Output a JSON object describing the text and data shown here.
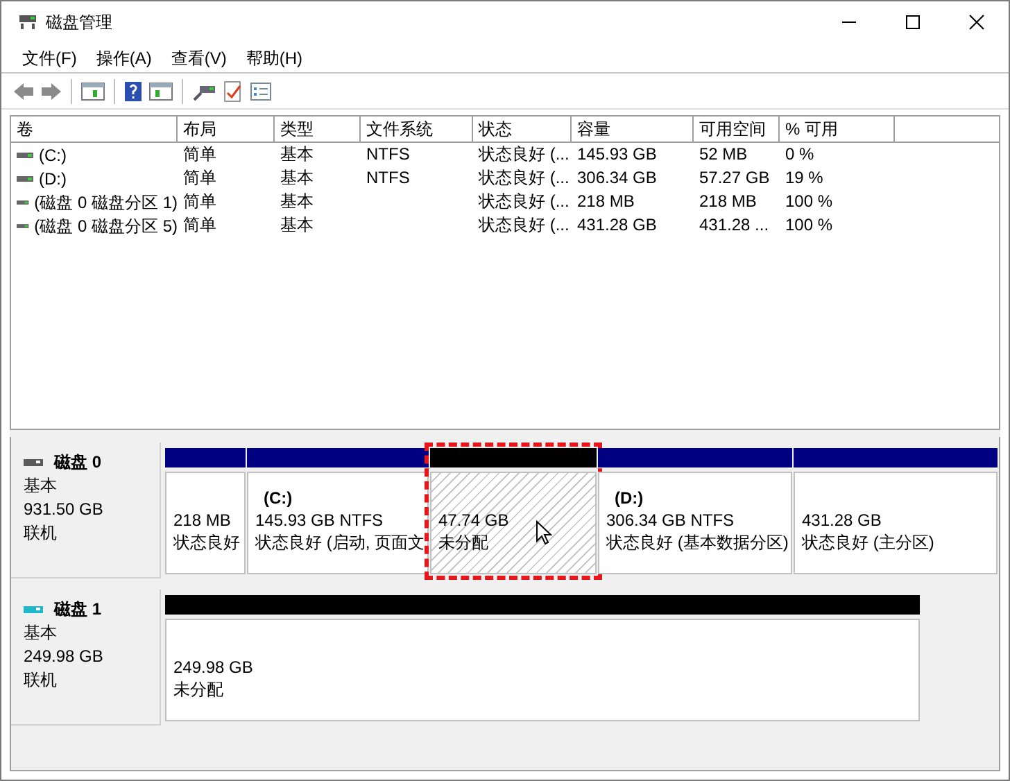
{
  "window": {
    "title": "磁盘管理"
  },
  "menu": [
    "文件(F)",
    "操作(A)",
    "查看(V)",
    "帮助(H)"
  ],
  "volumes_table": {
    "columns": [
      "卷",
      "布局",
      "类型",
      "文件系统",
      "状态",
      "容量",
      "可用空间",
      "% 可用"
    ],
    "rows": [
      [
        "(C:)",
        "简单",
        "基本",
        "NTFS",
        "状态良好 (...",
        "145.93 GB",
        "52 MB",
        "0 %"
      ],
      [
        "(D:)",
        "简单",
        "基本",
        "NTFS",
        "状态良好 (...",
        "306.34 GB",
        "57.27 GB",
        "19 %"
      ],
      [
        "(磁盘 0 磁盘分区 1)",
        "简单",
        "基本",
        "",
        "状态良好 (...",
        "218 MB",
        "218 MB",
        "100 %"
      ],
      [
        "(磁盘 0 磁盘分区 5)",
        "简单",
        "基本",
        "",
        "状态良好 (...",
        "431.28 GB",
        "431.28 ...",
        "100 %"
      ]
    ]
  },
  "disks": [
    {
      "name": "磁盘 0",
      "type": "基本",
      "size": "931.50 GB",
      "state": "联机",
      "color": "#5a5a5a",
      "partitions": [
        {
          "kind": "primary",
          "size": "218 MB",
          "status": "状态良好",
          "highlighted": false
        },
        {
          "kind": "primary",
          "label": "(C:)",
          "size": "145.93 GB NTFS",
          "status": "状态良好 (启动, 页面文",
          "highlighted": false
        },
        {
          "kind": "unallocated",
          "size": "47.74 GB",
          "status": "未分配",
          "highlighted": true
        },
        {
          "kind": "primary",
          "label": "(D:)",
          "size": "306.34 GB NTFS",
          "status": "状态良好 (基本数据分区)",
          "highlighted": false
        },
        {
          "kind": "primary",
          "size": "431.28 GB",
          "status": "状态良好 (主分区)",
          "highlighted": false
        }
      ]
    },
    {
      "name": "磁盘 1",
      "type": "基本",
      "size": "249.98 GB",
      "state": "联机",
      "color": "#20b8c8",
      "partitions": [
        {
          "kind": "unallocated_plain",
          "size": "249.98 GB",
          "status": "未分配",
          "highlighted": false
        }
      ]
    }
  ]
}
